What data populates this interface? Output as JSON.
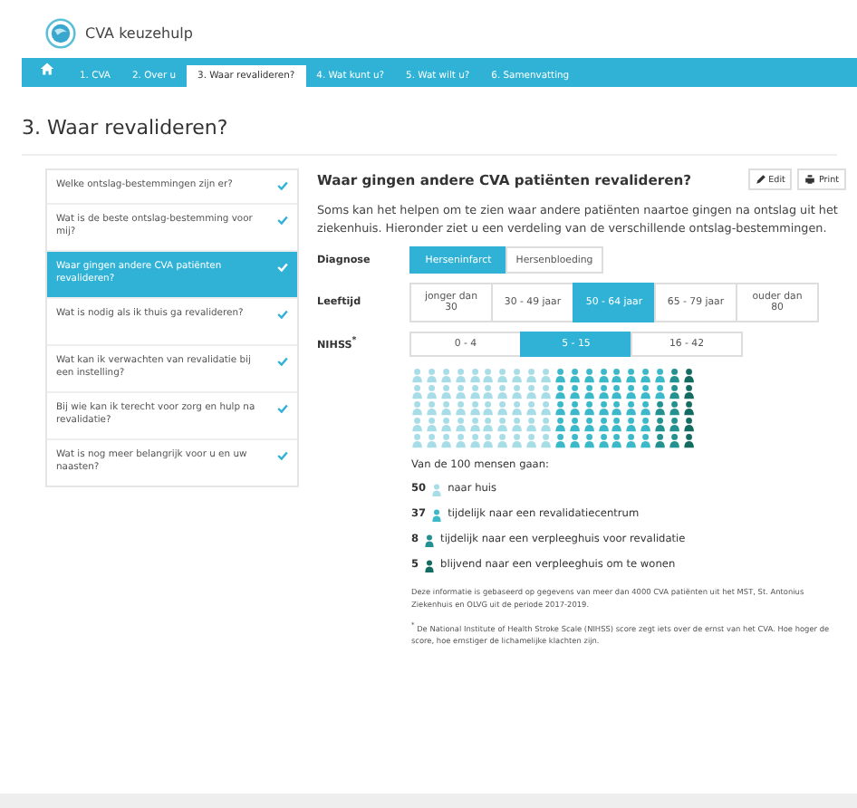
{
  "brand": "CVA keuzehulp",
  "nav": [
    {
      "label": "1. CVA",
      "selected": false
    },
    {
      "label": "2. Over u",
      "selected": false
    },
    {
      "label": "3. Waar revalideren?",
      "selected": true
    },
    {
      "label": "4. Wat kunt u?",
      "selected": false
    },
    {
      "label": "5. Wat wilt u?",
      "selected": false
    },
    {
      "label": "6. Samenvatting",
      "selected": false
    }
  ],
  "page_title": "3. Waar revalideren?",
  "sidebar": [
    {
      "label": "Welke ontslag-bestemmingen zijn er?",
      "selected": false,
      "checked": true
    },
    {
      "label": "Wat is de beste ontslag-bestemming voor mij?",
      "selected": false,
      "checked": true
    },
    {
      "label": "Waar gingen andere CVA patiënten revalideren?",
      "selected": true,
      "checked": true
    },
    {
      "label": "Wat is nodig als ik thuis ga revalideren?",
      "selected": false,
      "checked": true
    },
    {
      "label": "Wat kan ik verwachten van revalidatie bij een instelling?",
      "selected": false,
      "checked": true
    },
    {
      "label": "Bij wie kan ik terecht voor zorg en hulp na revalidatie?",
      "selected": false,
      "checked": true
    },
    {
      "label": "Wat is nog meer belangrijk voor u en uw naasten?",
      "selected": false,
      "checked": true
    }
  ],
  "section": {
    "title": "Waar gingen andere CVA patiënten revalideren?",
    "actions": [
      "Edit",
      "Print"
    ],
    "intro": "Soms kan het helpen om te zien waar andere patiënten naartoe gingen na ontslag uit het ziekenhuis. Hieronder ziet u een verdeling van de verschillende ontslag-bestemmingen.",
    "filters": [
      {
        "label": "Diagnose",
        "options": [
          {
            "label": "Herseninfarct",
            "selected": true
          },
          {
            "label": "Hersenbloeding",
            "selected": false
          }
        ]
      },
      {
        "label": "Leeftijd",
        "options": [
          {
            "label": "jonger dan 30",
            "selected": false
          },
          {
            "label": "30 - 49 jaar",
            "selected": false
          },
          {
            "label": "50 - 64 jaar",
            "selected": true
          },
          {
            "label": "65 - 79 jaar",
            "selected": false
          },
          {
            "label": "ouder dan 80",
            "selected": false
          }
        ]
      },
      {
        "label": "NIHSS$^{*}$",
        "options": [
          {
            "label": "0 - 4",
            "selected": false
          },
          {
            "label": "5 - 15",
            "selected": true
          },
          {
            "label": "16 - 42",
            "selected": false
          }
        ]
      }
    ],
    "summary": "Van de 100 mensen gaan:",
    "outcomes": [
      {
        "count": "50",
        "label": "naar huis",
        "color": "#a6dde6"
      },
      {
        "count": "37",
        "label": "tijdelijk naar een revalidatiecentrum",
        "color": "#3bb8c9"
      },
      {
        "count": "8",
        "label": "tijdelijk naar een verpleeghuis voor revalidatie",
        "color": "#23918f"
      },
      {
        "count": "5",
        "label": "blijvend naar een verpleeghuis om te wonen",
        "color": "#146b60"
      }
    ],
    "source_note": "Deze informatie is gebaseerd op gegevens van meer dan 4000 CVA patiënten uit het MST, St. Antonius Ziekenhuis en OLVG uit de periode 2017-2019.",
    "footnote": "$^{*}$ De National Institute of Health Stroke Scale (NIHSS) score zegt iets over de ernst van het CVA. Hoe hoger de score, hoe ernstiger de lichamelijke klachten zijn."
  }
}
